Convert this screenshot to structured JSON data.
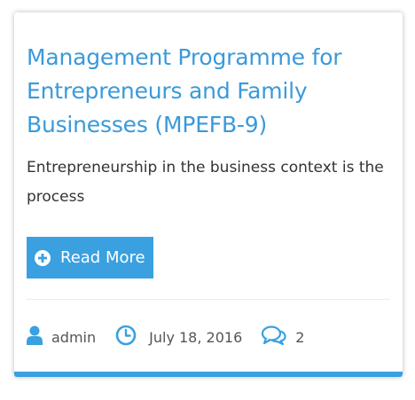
{
  "post": {
    "title": "Management Programme for Entrepreneurs and Family Businesses (MPEFB-9)",
    "excerpt": "Entrepreneurship in the business context is the process",
    "read_more_label": "Read More",
    "read_more_icon": "plus-circle-icon",
    "meta": {
      "author": "admin",
      "author_icon": "user-icon",
      "date": "July 18, 2016",
      "date_icon": "clock-icon",
      "comments": "2",
      "comments_icon": "comments-icon"
    }
  },
  "colors": {
    "accent": "#3aa0e0",
    "title": "#3a9ad9",
    "text": "#333333",
    "meta_text": "#555555"
  }
}
